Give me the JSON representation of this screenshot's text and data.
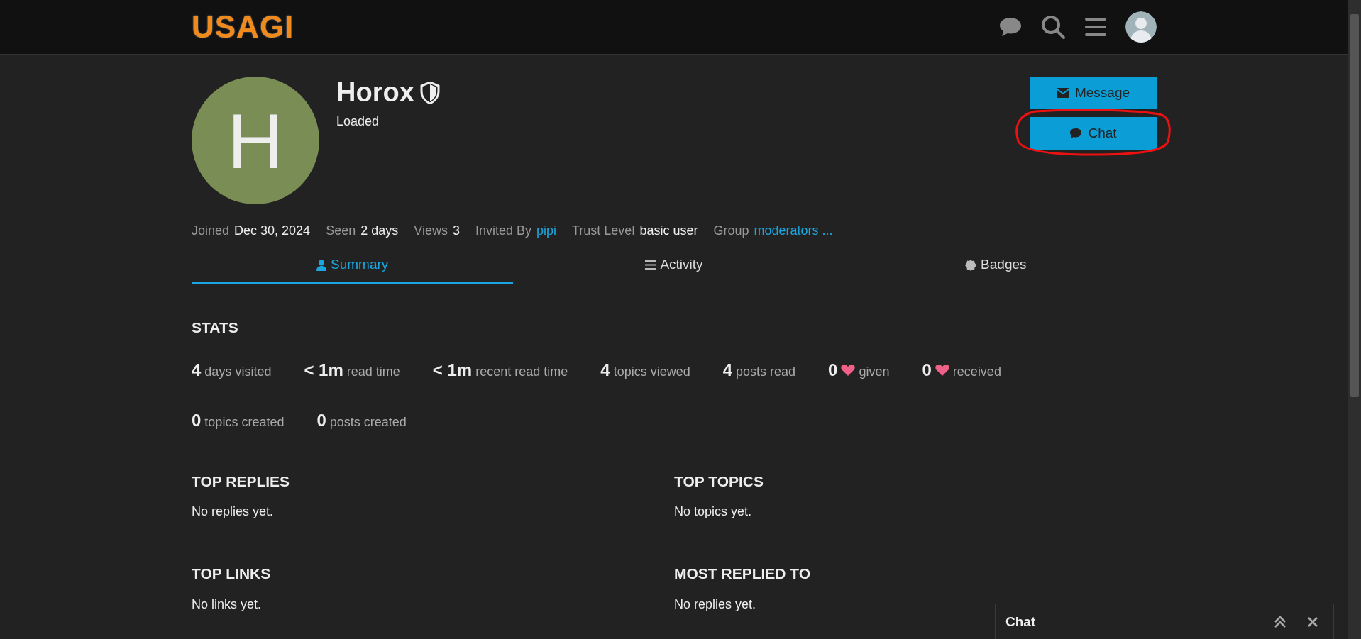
{
  "header": {
    "logo": "USAGI"
  },
  "profile": {
    "initial": "H",
    "name": "Horox",
    "title": "Loaded"
  },
  "buttons": [
    {
      "label": "Message",
      "kind": "envelope",
      "annotated": false
    },
    {
      "label": "Chat",
      "kind": "bubble",
      "annotated": true
    }
  ],
  "meta": [
    {
      "label": "Joined",
      "value": "Dec 30, 2024",
      "kind": "text"
    },
    {
      "label": "Seen",
      "value": "2 days",
      "kind": "text"
    },
    {
      "label": "Views",
      "value": "3",
      "kind": "text"
    },
    {
      "label": "Invited By",
      "value": "pipi",
      "kind": "link"
    },
    {
      "label": "Trust Level",
      "value": "basic user",
      "kind": "text"
    },
    {
      "label": "Group",
      "value": "moderators ...",
      "kind": "link"
    }
  ],
  "tabs": [
    {
      "label": "Summary",
      "kind": "user",
      "selected": true
    },
    {
      "label": "Activity",
      "kind": "lines",
      "selected": false
    },
    {
      "label": "Badges",
      "kind": "badge",
      "selected": false
    }
  ],
  "stats": {
    "title": "STATS",
    "rows": [
      [
        {
          "value": "4",
          "label": "days visited",
          "kind": "plain"
        },
        {
          "value": "< 1m",
          "label": "read time",
          "kind": "plain"
        },
        {
          "value": "< 1m",
          "label": "recent read time",
          "kind": "plain"
        },
        {
          "value": "4",
          "label": "topics viewed",
          "kind": "plain"
        },
        {
          "value": "4",
          "label": "posts read",
          "kind": "plain"
        },
        {
          "value": "0",
          "label": "given",
          "kind": "heart"
        },
        {
          "value": "0",
          "label": "received",
          "kind": "heart"
        }
      ],
      [
        {
          "value": "0",
          "label": "topics created",
          "kind": "plain"
        },
        {
          "value": "0",
          "label": "posts created",
          "kind": "plain"
        }
      ]
    ]
  },
  "sections": [
    {
      "title": "TOP REPLIES",
      "empty": "No replies yet."
    },
    {
      "title": "TOP TOPICS",
      "empty": "No topics yet."
    },
    {
      "title": "TOP LINKS",
      "empty": "No links yet."
    },
    {
      "title": "MOST REPLIED TO",
      "empty": "No replies yet."
    }
  ],
  "chat_panel": {
    "title": "Chat"
  }
}
